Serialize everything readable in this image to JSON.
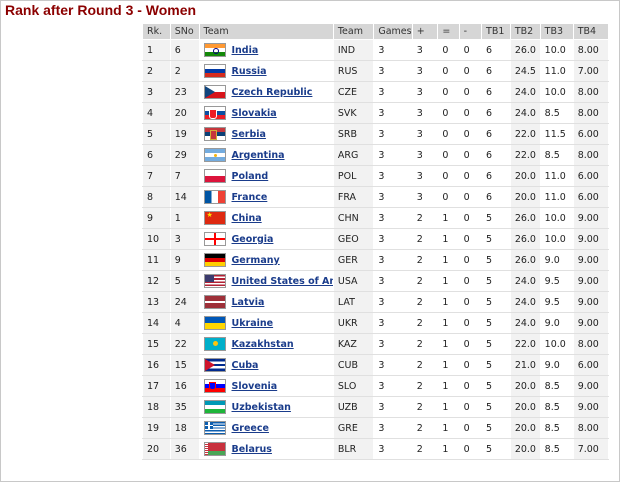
{
  "page": {
    "title": "Rank after Round 3 - Women"
  },
  "table": {
    "headers": [
      "Rk.",
      "SNo",
      "Team",
      "Team",
      "Games",
      "+",
      "=",
      "-",
      "TB1",
      "TB2",
      "TB3",
      "TB4"
    ],
    "rows": [
      {
        "rk": "1",
        "sno": "6",
        "team": "India",
        "code": "IND",
        "flag": "india-flag-icon",
        "games": "3",
        "w": "3",
        "d": "0",
        "l": "0",
        "tb1": "6",
        "tb2": "26.0",
        "tb3": "10.0",
        "tb4": "8.00"
      },
      {
        "rk": "2",
        "sno": "2",
        "team": "Russia",
        "code": "RUS",
        "flag": "russia-flag-icon",
        "games": "3",
        "w": "3",
        "d": "0",
        "l": "0",
        "tb1": "6",
        "tb2": "24.5",
        "tb3": "11.0",
        "tb4": "7.00"
      },
      {
        "rk": "3",
        "sno": "23",
        "team": "Czech Republic",
        "code": "CZE",
        "flag": "czech-republic-flag-icon",
        "games": "3",
        "w": "3",
        "d": "0",
        "l": "0",
        "tb1": "6",
        "tb2": "24.0",
        "tb3": "10.0",
        "tb4": "8.00"
      },
      {
        "rk": "4",
        "sno": "20",
        "team": "Slovakia",
        "code": "SVK",
        "flag": "slovakia-flag-icon",
        "games": "3",
        "w": "3",
        "d": "0",
        "l": "0",
        "tb1": "6",
        "tb2": "24.0",
        "tb3": "8.5",
        "tb4": "8.00"
      },
      {
        "rk": "5",
        "sno": "19",
        "team": "Serbia",
        "code": "SRB",
        "flag": "serbia-flag-icon",
        "games": "3",
        "w": "3",
        "d": "0",
        "l": "0",
        "tb1": "6",
        "tb2": "22.0",
        "tb3": "11.5",
        "tb4": "6.00"
      },
      {
        "rk": "6",
        "sno": "29",
        "team": "Argentina",
        "code": "ARG",
        "flag": "argentina-flag-icon",
        "games": "3",
        "w": "3",
        "d": "0",
        "l": "0",
        "tb1": "6",
        "tb2": "22.0",
        "tb3": "8.5",
        "tb4": "8.00"
      },
      {
        "rk": "7",
        "sno": "7",
        "team": "Poland",
        "code": "POL",
        "flag": "poland-flag-icon",
        "games": "3",
        "w": "3",
        "d": "0",
        "l": "0",
        "tb1": "6",
        "tb2": "20.0",
        "tb3": "11.0",
        "tb4": "6.00"
      },
      {
        "rk": "8",
        "sno": "14",
        "team": "France",
        "code": "FRA",
        "flag": "france-flag-icon",
        "games": "3",
        "w": "3",
        "d": "0",
        "l": "0",
        "tb1": "6",
        "tb2": "20.0",
        "tb3": "11.0",
        "tb4": "6.00"
      },
      {
        "rk": "9",
        "sno": "1",
        "team": "China",
        "code": "CHN",
        "flag": "china-flag-icon",
        "games": "3",
        "w": "2",
        "d": "1",
        "l": "0",
        "tb1": "5",
        "tb2": "26.0",
        "tb3": "10.0",
        "tb4": "9.00"
      },
      {
        "rk": "10",
        "sno": "3",
        "team": "Georgia",
        "code": "GEO",
        "flag": "georgia-flag-icon",
        "games": "3",
        "w": "2",
        "d": "1",
        "l": "0",
        "tb1": "5",
        "tb2": "26.0",
        "tb3": "10.0",
        "tb4": "9.00"
      },
      {
        "rk": "11",
        "sno": "9",
        "team": "Germany",
        "code": "GER",
        "flag": "germany-flag-icon",
        "games": "3",
        "w": "2",
        "d": "1",
        "l": "0",
        "tb1": "5",
        "tb2": "26.0",
        "tb3": "9.0",
        "tb4": "9.00"
      },
      {
        "rk": "12",
        "sno": "5",
        "team": "United States of America",
        "code": "USA",
        "flag": "usa-flag-icon",
        "games": "3",
        "w": "2",
        "d": "1",
        "l": "0",
        "tb1": "5",
        "tb2": "24.0",
        "tb3": "9.5",
        "tb4": "9.00"
      },
      {
        "rk": "13",
        "sno": "24",
        "team": "Latvia",
        "code": "LAT",
        "flag": "latvia-flag-icon",
        "games": "3",
        "w": "2",
        "d": "1",
        "l": "0",
        "tb1": "5",
        "tb2": "24.0",
        "tb3": "9.5",
        "tb4": "9.00"
      },
      {
        "rk": "14",
        "sno": "4",
        "team": "Ukraine",
        "code": "UKR",
        "flag": "ukraine-flag-icon",
        "games": "3",
        "w": "2",
        "d": "1",
        "l": "0",
        "tb1": "5",
        "tb2": "24.0",
        "tb3": "9.0",
        "tb4": "9.00"
      },
      {
        "rk": "15",
        "sno": "22",
        "team": "Kazakhstan",
        "code": "KAZ",
        "flag": "kazakhstan-flag-icon",
        "games": "3",
        "w": "2",
        "d": "1",
        "l": "0",
        "tb1": "5",
        "tb2": "22.0",
        "tb3": "10.0",
        "tb4": "8.00"
      },
      {
        "rk": "16",
        "sno": "15",
        "team": "Cuba",
        "code": "CUB",
        "flag": "cuba-flag-icon",
        "games": "3",
        "w": "2",
        "d": "1",
        "l": "0",
        "tb1": "5",
        "tb2": "21.0",
        "tb3": "9.0",
        "tb4": "6.00"
      },
      {
        "rk": "17",
        "sno": "16",
        "team": "Slovenia",
        "code": "SLO",
        "flag": "slovenia-flag-icon",
        "games": "3",
        "w": "2",
        "d": "1",
        "l": "0",
        "tb1": "5",
        "tb2": "20.0",
        "tb3": "8.5",
        "tb4": "9.00"
      },
      {
        "rk": "18",
        "sno": "35",
        "team": "Uzbekistan",
        "code": "UZB",
        "flag": "uzbekistan-flag-icon",
        "games": "3",
        "w": "2",
        "d": "1",
        "l": "0",
        "tb1": "5",
        "tb2": "20.0",
        "tb3": "8.5",
        "tb4": "9.00"
      },
      {
        "rk": "19",
        "sno": "18",
        "team": "Greece",
        "code": "GRE",
        "flag": "greece-flag-icon",
        "games": "3",
        "w": "2",
        "d": "1",
        "l": "0",
        "tb1": "5",
        "tb2": "20.0",
        "tb3": "8.5",
        "tb4": "8.00"
      },
      {
        "rk": "20",
        "sno": "36",
        "team": "Belarus",
        "code": "BLR",
        "flag": "belarus-flag-icon",
        "games": "3",
        "w": "2",
        "d": "1",
        "l": "0",
        "tb1": "5",
        "tb2": "20.0",
        "tb3": "8.5",
        "tb4": "7.00"
      }
    ]
  }
}
